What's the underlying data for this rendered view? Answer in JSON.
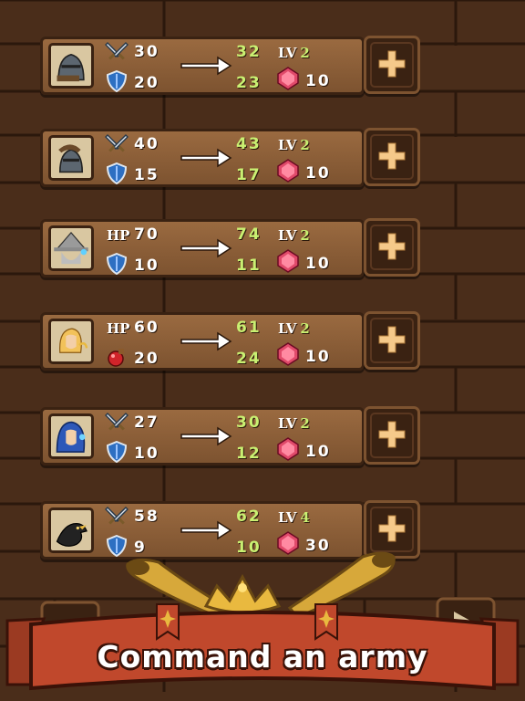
{
  "colors": {
    "highlight": "#c9f072",
    "wood": "#7d5330",
    "dark": "#3a2212",
    "banner": "#c0482c"
  },
  "units": [
    {
      "portrait": "knight-helmet",
      "stat1_icon": "crossed-swords-icon",
      "stat1_label": "",
      "stat1": "30",
      "stat2_icon": "shield-icon",
      "stat2": "20",
      "new1": "32",
      "new2": "23",
      "level_label": "LV",
      "level": "2",
      "cost": "10"
    },
    {
      "portrait": "spartan-warrior",
      "stat1_icon": "crossed-swords-icon",
      "stat1_label": "",
      "stat1": "40",
      "stat2_icon": "shield-icon",
      "stat2": "15",
      "new1": "43",
      "new2": "17",
      "level_label": "LV",
      "level": "2",
      "cost": "10"
    },
    {
      "portrait": "grey-wizard",
      "stat1_icon": "",
      "stat1_label": "HP",
      "stat1": "70",
      "stat2_icon": "shield-icon",
      "stat2": "10",
      "new1": "74",
      "new2": "11",
      "level_label": "LV",
      "level": "2",
      "cost": "10"
    },
    {
      "portrait": "blonde-priestess",
      "stat1_icon": "",
      "stat1_label": "HP",
      "stat1": "60",
      "stat2_icon": "healing-potion-icon",
      "stat2": "20",
      "new1": "61",
      "new2": "24",
      "level_label": "LV",
      "level": "2",
      "cost": "10"
    },
    {
      "portrait": "blue-hooded-mage",
      "stat1_icon": "crossed-swords-icon",
      "stat1_label": "",
      "stat1": "27",
      "stat2_icon": "shield-icon",
      "stat2": "10",
      "new1": "30",
      "new2": "12",
      "level_label": "LV",
      "level": "2",
      "cost": "10"
    },
    {
      "portrait": "black-raven",
      "stat1_icon": "crossed-swords-icon",
      "stat1_label": "",
      "stat1": "58",
      "stat2_icon": "shield-icon",
      "stat2": "9",
      "new1": "62",
      "new2": "10",
      "level_label": "LV",
      "level": "4",
      "cost": "30"
    }
  ],
  "banner": {
    "text": "Command an army"
  }
}
